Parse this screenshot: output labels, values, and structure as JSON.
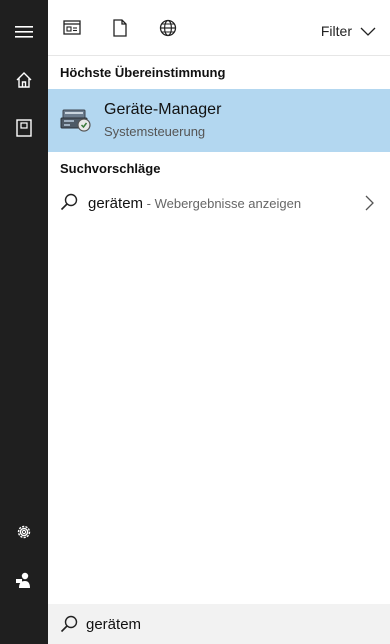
{
  "rail": {
    "items": [
      {
        "icon": "hamburger-menu-icon"
      },
      {
        "icon": "home-icon"
      },
      {
        "icon": "notebook-icon"
      },
      {
        "icon": "gear-icon"
      },
      {
        "icon": "feedback-person-icon"
      }
    ]
  },
  "topbar": {
    "scopes": [
      {
        "icon": "apps-window-icon"
      },
      {
        "icon": "document-icon"
      },
      {
        "icon": "globe-icon"
      }
    ],
    "filter_label": "Filter"
  },
  "best_match": {
    "heading": "Höchste Übereinstimmung",
    "title": "Geräte-Manager",
    "subtitle": "Systemsteuerung",
    "icon": "device-manager-icon"
  },
  "suggestions": {
    "heading": "Suchvorschläge",
    "items": [
      {
        "query": "gerätem",
        "hint": " - Webergebnisse anzeigen"
      }
    ]
  },
  "search": {
    "value": "gerätem"
  },
  "colors": {
    "rail_bg": "#1f1f1f",
    "highlight": "#b3d7f0",
    "search_bg": "#f2f2f2"
  }
}
